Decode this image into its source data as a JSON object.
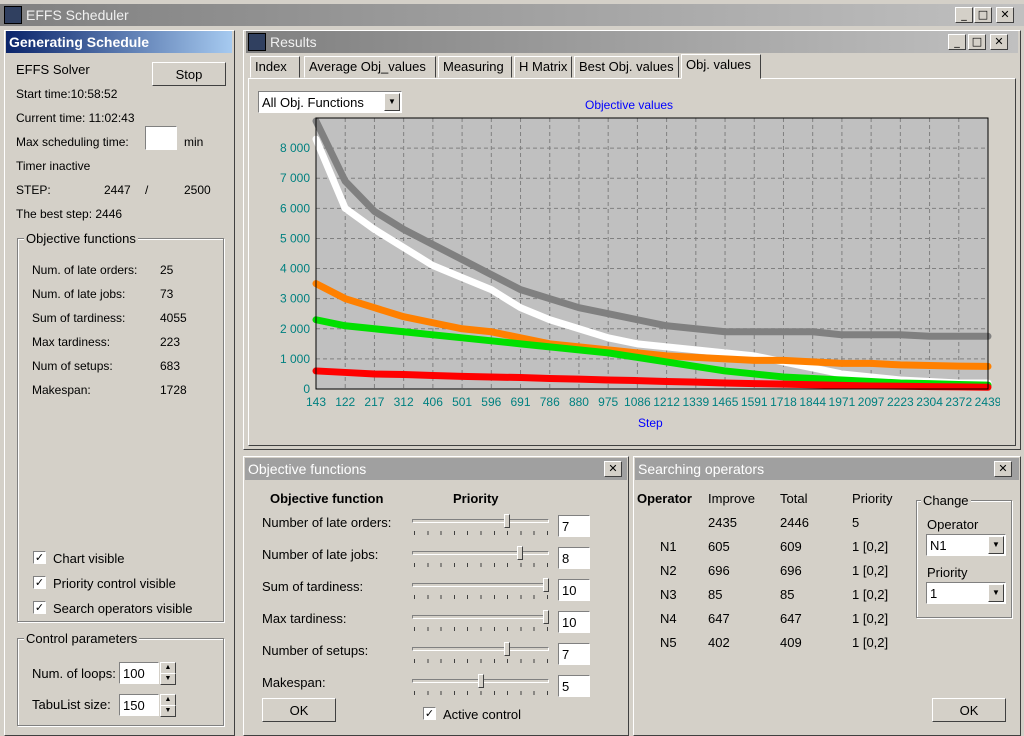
{
  "app": {
    "title": "EFFS Scheduler"
  },
  "left": {
    "title": "Generating Schedule",
    "solver": "EFFS Solver",
    "stop_label": "Stop",
    "start_time": "Start time:10:58:52",
    "current_time": "Current time: 11:02:43",
    "max_sched_label": "Max scheduling time:",
    "max_sched_value": "",
    "min_label": "min",
    "timer": "Timer inactive",
    "step_label": "STEP:",
    "step_current": "2447",
    "step_sep": "/",
    "step_total": "2500",
    "best_step": "The best step: 2446",
    "obj_group": "Objective functions",
    "objectives": [
      {
        "label": "Num. of late orders:",
        "value": "25"
      },
      {
        "label": "Num. of late jobs:",
        "value": "73"
      },
      {
        "label": "Sum of tardiness:",
        "value": "4055"
      },
      {
        "label": "Max tardiness:",
        "value": "223"
      },
      {
        "label": "Num of setups:",
        "value": "683"
      },
      {
        "label": "Makespan:",
        "value": "1728"
      }
    ],
    "checks": [
      {
        "label": "Chart visible",
        "checked": "✓"
      },
      {
        "label": "Priority control visible",
        "checked": "✓"
      },
      {
        "label": "Search operators visible",
        "checked": "✓"
      }
    ],
    "control_group": "Control parameters",
    "loops_label": "Num. of loops:",
    "loops_value": "100",
    "tabu_label": "TabuList size:",
    "tabu_value": "150"
  },
  "results": {
    "title": "Results",
    "tabs": [
      "Index",
      "Average Obj_values",
      "Measuring",
      "H Matrix",
      "Best Obj. values",
      "Obj. values"
    ],
    "active_tab": 5,
    "dropdown": "All Obj. Functions"
  },
  "chart_data": {
    "type": "line",
    "title": "Objective values",
    "xlabel": "Step",
    "ylabel": "",
    "x_ticks": [
      "143",
      "122",
      "217",
      "312",
      "406",
      "501",
      "596",
      "691",
      "786",
      "880",
      "975",
      "1086",
      "1212",
      "1339",
      "1465",
      "1591",
      "1718",
      "1844",
      "1971",
      "2097",
      "2223",
      "2304",
      "2372",
      "2439"
    ],
    "y_ticks": [
      "0",
      "1 000",
      "2 000",
      "3 000",
      "4 000",
      "5 000",
      "6 000",
      "7 000",
      "8 000"
    ],
    "ylim": [
      0,
      9000
    ],
    "grid": true,
    "series": [
      {
        "color": "#808080",
        "values": [
          8900,
          6900,
          5900,
          5300,
          4800,
          4300,
          3800,
          3300,
          3000,
          2700,
          2500,
          2300,
          2100,
          2000,
          1900,
          1900,
          1900,
          1900,
          1800,
          1800,
          1800,
          1750,
          1750,
          1750
        ]
      },
      {
        "color": "#ffffff",
        "values": [
          8300,
          6000,
          5300,
          4700,
          4100,
          3700,
          3300,
          2700,
          2300,
          2000,
          1700,
          1500,
          1400,
          1300,
          1200,
          1100,
          900,
          700,
          500,
          400,
          300,
          250,
          200,
          200
        ]
      },
      {
        "color": "#ff8000",
        "values": [
          3500,
          3000,
          2700,
          2400,
          2200,
          2000,
          1900,
          1700,
          1500,
          1400,
          1300,
          1200,
          1100,
          1050,
          1000,
          950,
          950,
          900,
          850,
          850,
          800,
          780,
          760,
          750
        ]
      },
      {
        "color": "#00e000",
        "values": [
          2300,
          2100,
          2000,
          1900,
          1800,
          1700,
          1600,
          1500,
          1400,
          1300,
          1200,
          1050,
          900,
          750,
          600,
          500,
          400,
          350,
          300,
          250,
          200,
          180,
          150,
          130
        ]
      },
      {
        "color": "#ff0000",
        "values": [
          600,
          550,
          500,
          480,
          450,
          420,
          400,
          380,
          350,
          330,
          300,
          280,
          250,
          230,
          200,
          180,
          160,
          140,
          120,
          100,
          90,
          80,
          70,
          60
        ]
      }
    ]
  },
  "priority": {
    "title": "Objective functions",
    "col1": "Objective function",
    "col2": "Priority",
    "rows": [
      {
        "label": "Number of late orders:",
        "value": "7",
        "level": 0.7
      },
      {
        "label": "Number of late jobs:",
        "value": "8",
        "level": 0.8
      },
      {
        "label": "Sum of tardiness:",
        "value": "10",
        "level": 1.0
      },
      {
        "label": "Max tardiness:",
        "value": "10",
        "level": 1.0
      },
      {
        "label": "Number of setups:",
        "value": "7",
        "level": 0.7
      },
      {
        "label": "Makespan:",
        "value": "5",
        "level": 0.5
      }
    ],
    "ok_label": "OK",
    "active_label": "Active control",
    "active_checked": "✓"
  },
  "operators": {
    "title": "Searching operators",
    "headers": [
      "Operator",
      "Improve",
      "Total",
      "Priority"
    ],
    "rows": [
      {
        "op": "",
        "improve": "2435",
        "total": "2446",
        "priority": "5"
      },
      {
        "op": "N1",
        "improve": "605",
        "total": "609",
        "priority": "1 [0,2]"
      },
      {
        "op": "N2",
        "improve": "696",
        "total": "696",
        "priority": "1 [0,2]"
      },
      {
        "op": "N3",
        "improve": "85",
        "total": "85",
        "priority": "1 [0,2]"
      },
      {
        "op": "N4",
        "improve": "647",
        "total": "647",
        "priority": "1 [0,2]"
      },
      {
        "op": "N5",
        "improve": "402",
        "total": "409",
        "priority": "1 [0,2]"
      }
    ],
    "change_group": "Change",
    "operator_label": "Operator",
    "operator_value": "N1",
    "priority_label": "Priority",
    "priority_value": "1",
    "ok_label": "OK"
  },
  "colors": {
    "title_active": "#0a246a",
    "title_inactive": "#808080",
    "axis_text": "#008080",
    "chart_title": "#0000ff"
  }
}
